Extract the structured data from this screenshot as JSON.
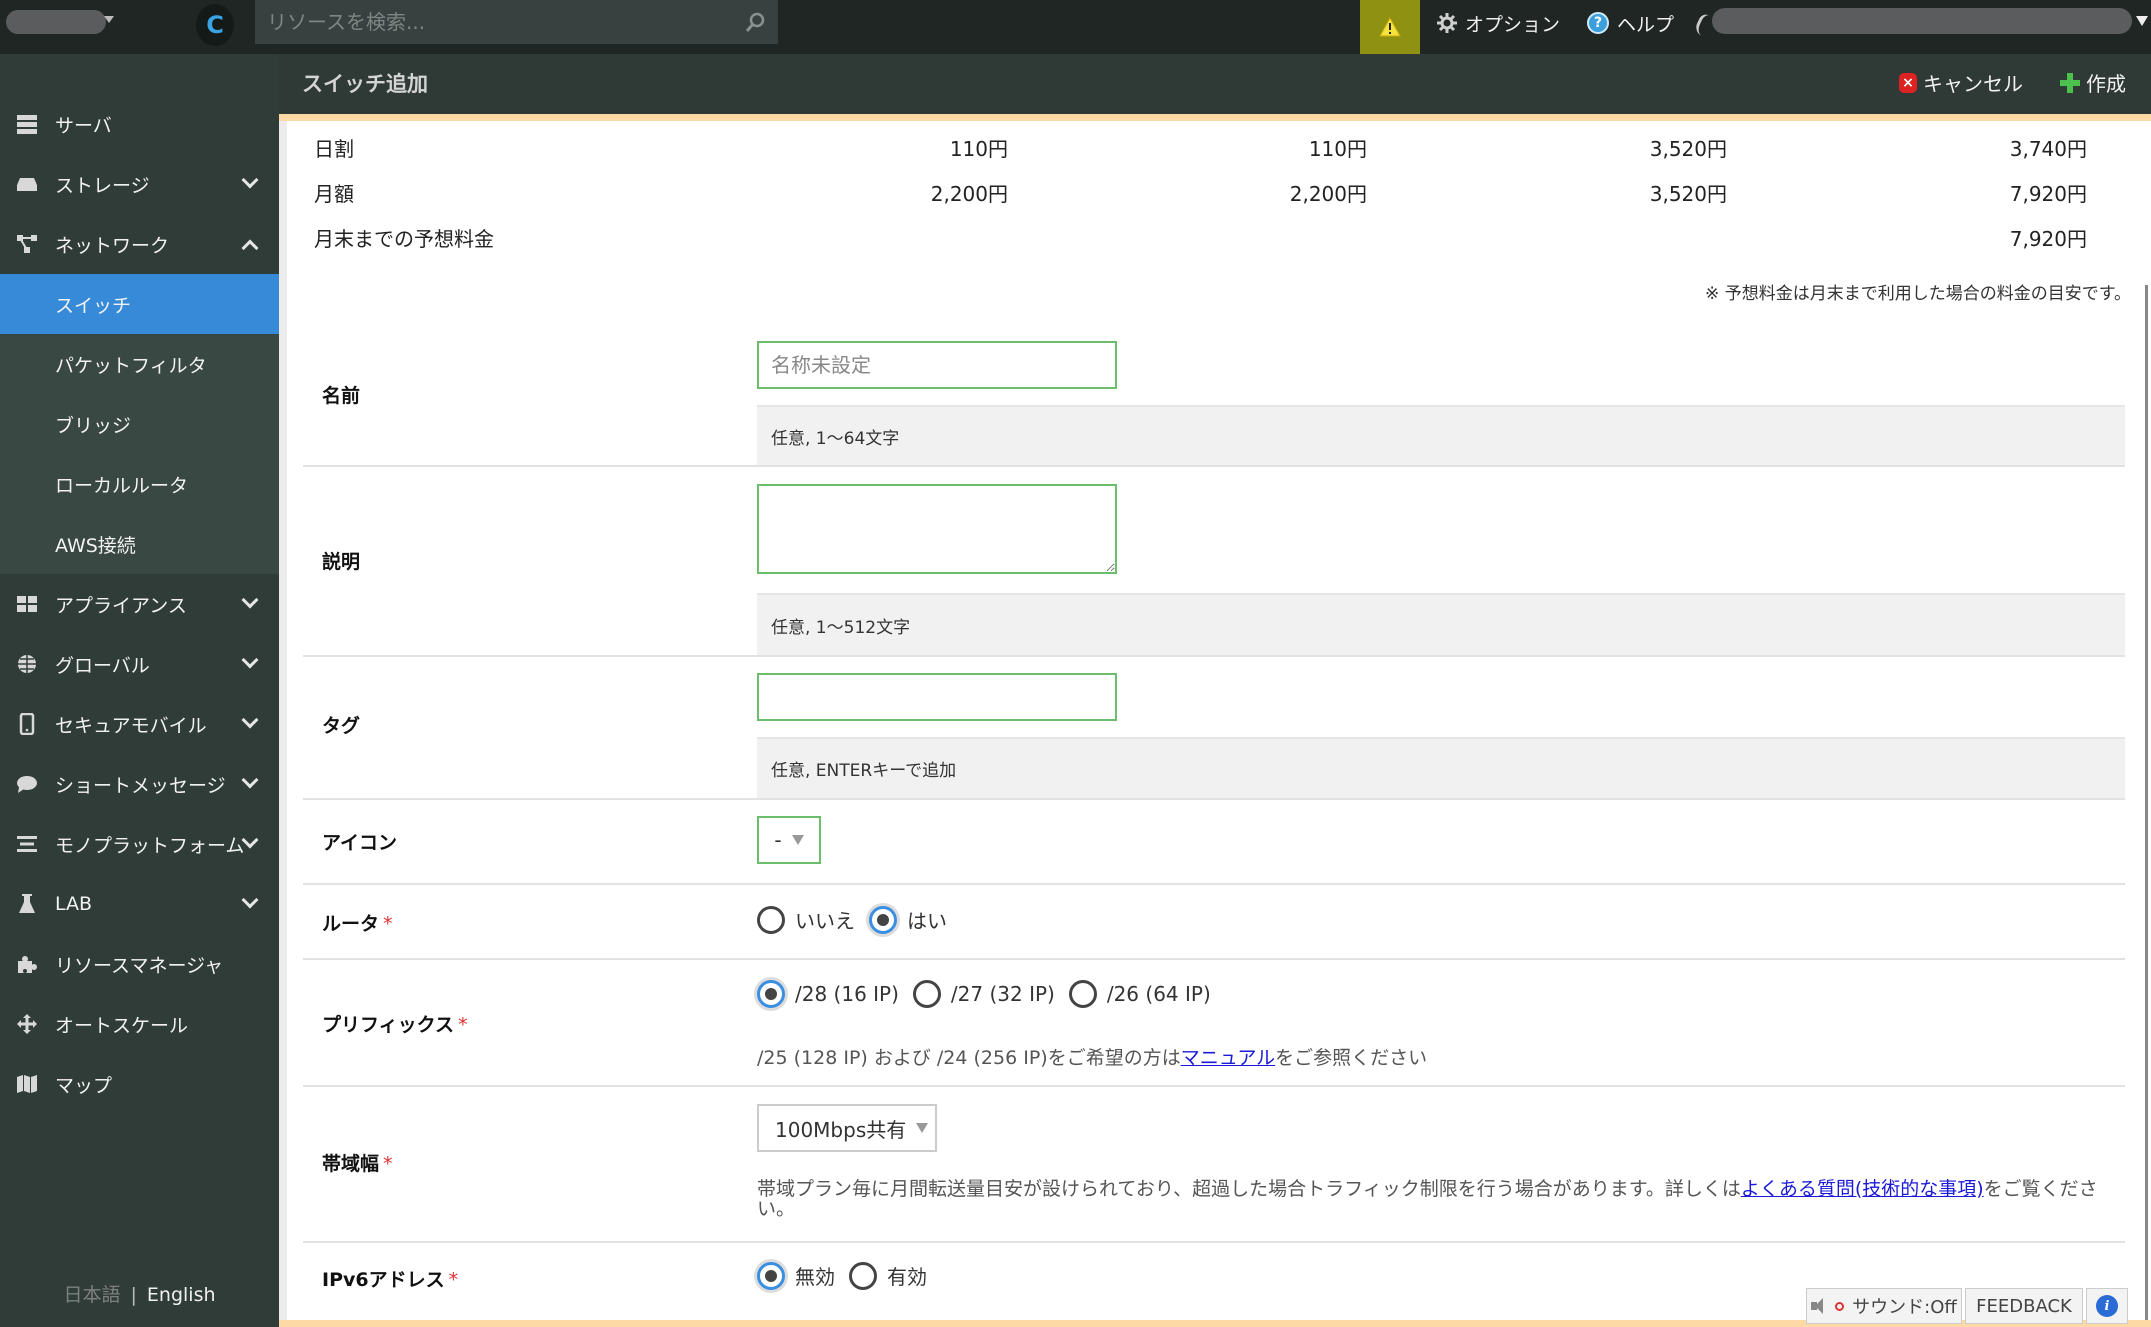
{
  "topbar": {
    "search_placeholder": "リソースを検索...",
    "options_label": "オプション",
    "help_label": "ヘルプ",
    "refresh_glyph": "C",
    "help_glyph": "?"
  },
  "sidebar": {
    "items": [
      {
        "label": "サーバ",
        "icon": "server-icon",
        "expandable": false
      },
      {
        "label": "ストレージ",
        "icon": "storage-icon",
        "expandable": true,
        "expanded": false
      },
      {
        "label": "ネットワーク",
        "icon": "network-icon",
        "expandable": true,
        "expanded": true
      },
      {
        "label": "アプライアンス",
        "icon": "appliance-icon",
        "expandable": true,
        "expanded": false
      },
      {
        "label": "グローバル",
        "icon": "globe-icon",
        "expandable": true,
        "expanded": false
      },
      {
        "label": "セキュアモバイル",
        "icon": "mobile-icon",
        "expandable": true,
        "expanded": false
      },
      {
        "label": "ショートメッセージ",
        "icon": "chat-icon",
        "expandable": true,
        "expanded": false
      },
      {
        "label": "モノプラットフォーム",
        "icon": "platform-icon",
        "expandable": true,
        "expanded": false
      },
      {
        "label": "LAB",
        "icon": "flask-icon",
        "expandable": true,
        "expanded": false
      },
      {
        "label": "リソースマネージャ",
        "icon": "puzzle-icon",
        "expandable": false
      },
      {
        "label": "オートスケール",
        "icon": "move-arrows-icon",
        "expandable": false
      },
      {
        "label": "マップ",
        "icon": "map-icon",
        "expandable": false
      }
    ],
    "network_sub": [
      {
        "label": "スイッチ",
        "active": true
      },
      {
        "label": "パケットフィルタ",
        "active": false
      },
      {
        "label": "ブリッジ",
        "active": false
      },
      {
        "label": "ローカルルータ",
        "active": false
      },
      {
        "label": "AWS接続",
        "active": false
      }
    ],
    "lang_ja": "日本語",
    "lang_sep": "|",
    "lang_en": "English"
  },
  "header": {
    "title": "スイッチ追加",
    "cancel_label": "キャンセル",
    "create_label": "作成",
    "cancel_glyph": "×"
  },
  "pricing": {
    "rows": [
      {
        "label": "日割",
        "values": [
          "110円",
          "110円",
          "3,520円",
          "3,740円"
        ]
      },
      {
        "label": "月額",
        "values": [
          "2,200円",
          "2,200円",
          "3,520円",
          "7,920円"
        ]
      },
      {
        "label": "月末までの予想料金",
        "values": [
          "",
          "",
          "",
          "7,920円"
        ]
      }
    ],
    "note": "※ 予想料金は月末まで利用した場合の料金の目安です。"
  },
  "form": {
    "name": {
      "label": "名前",
      "placeholder": "名称未設定",
      "value": "",
      "hint": "任意, 1〜64文字"
    },
    "description": {
      "label": "説明",
      "value": "",
      "hint": "任意, 1〜512文字"
    },
    "tags": {
      "label": "タグ",
      "value": "",
      "hint": "任意, ENTERキーで追加"
    },
    "icon": {
      "label": "アイコン",
      "selected": "-"
    },
    "router": {
      "label": "ルータ",
      "required_mark": "*",
      "options": [
        "いいえ",
        "はい"
      ],
      "selected": "はい"
    },
    "prefix": {
      "label": "プリフィックス",
      "required_mark": "*",
      "options": [
        "/28 (16 IP)",
        "/27 (32 IP)",
        "/26 (64 IP)"
      ],
      "selected": "/28 (16 IP)",
      "note_before": "/25 (128 IP) および /24 (256 IP)をご希望の方は",
      "note_link": "マニュアル",
      "note_after": "をご参照ください"
    },
    "bandwidth": {
      "label": "帯域幅",
      "required_mark": "*",
      "selected": "100Mbps共有",
      "note_before": "帯域プラン毎に月間転送量目安が設けられており、超過した場合トラフィック制限を行う場合があります。詳しくは",
      "note_link": "よくある質問(技術的な事項)",
      "note_after": "をご覧ください。"
    },
    "ipv6": {
      "label": "IPv6アドレス",
      "required_mark": "*",
      "options": [
        "無効",
        "有効"
      ],
      "selected": "無効"
    }
  },
  "footer_widgets": {
    "sound_label": "サウンド:Off",
    "feedback_label": "FEEDBACK",
    "info_glyph": "i"
  },
  "colors": {
    "accent_blue": "#378ad7",
    "warning_bg": "#8f9113",
    "accent_stripe": "#fdd9a5",
    "input_border": "#6cbd6c"
  }
}
